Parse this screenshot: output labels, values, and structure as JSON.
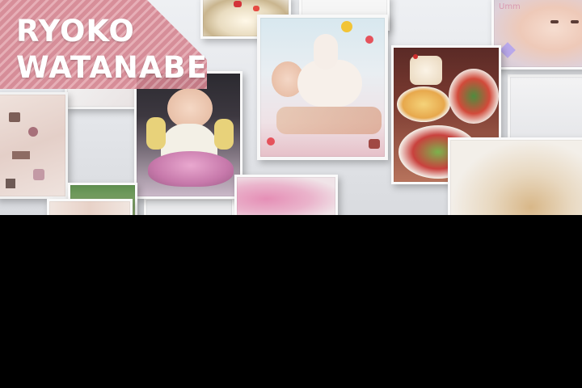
{
  "overlay": {
    "name_first": "RYOKO",
    "name_last": "WATANABE"
  },
  "photo_labels": {
    "umm": "Umm"
  },
  "colors": {
    "stripe_pink": "#d6818f",
    "background": "#e6e8eb",
    "letterbox": "#000000"
  },
  "photos": [
    {
      "id": "cake",
      "subject": "cake"
    },
    {
      "id": "baby-top-right",
      "subject": "baby face"
    },
    {
      "id": "notebook",
      "subject": "notebook with stickers"
    },
    {
      "id": "baby-chair",
      "subject": "baby in pink seat"
    },
    {
      "id": "baby-lying",
      "subject": "baby lying decorated"
    },
    {
      "id": "food-plates",
      "subject": "party food"
    },
    {
      "id": "blurry-right",
      "subject": "blurred photo"
    },
    {
      "id": "pink-bottom",
      "subject": "pink blur"
    }
  ]
}
